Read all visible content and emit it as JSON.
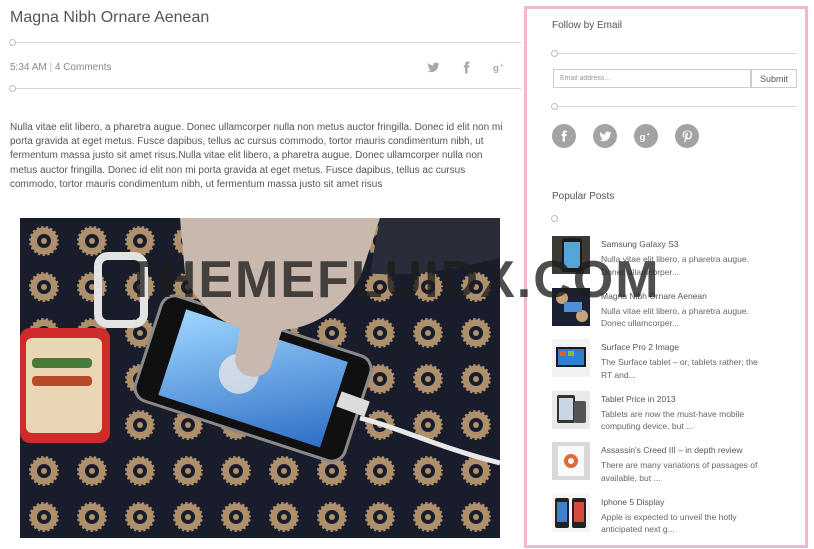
{
  "post": {
    "title": "Magna Nibh Ornare Aenean",
    "time": "5:34 AM",
    "comments": "4 Comments",
    "share_icons": [
      "twitter-icon",
      "facebook-icon",
      "google-plus-icon"
    ],
    "body": "Nulla vitae elit libero, a pharetra augue. Donec ullamcorper nulla non metus auctor fringilla. Donec id elit non mi porta gravida at eget metus. Fusce dapibus, tellus ac cursus commodo, tortor mauris condimentum nibh, ut fermentum massa justo sit amet risus.Nulla vitae elit libero, a pharetra augue. Donec ullamcorper nulla non metus auctor fringilla. Donec id elit non mi porta gravida at eget metus. Fusce dapibus, tellus ac cursus commodo, tortor mauris condimentum nibh, ut fermentum massa justo sit amet risus"
  },
  "sidebar": {
    "follow": {
      "title": "Follow by Email",
      "placeholder": "Email address...",
      "submit": "Submit"
    },
    "social": [
      "facebook-icon",
      "twitter-icon",
      "google-plus-icon",
      "pinterest-icon"
    ],
    "popular": {
      "title": "Popular Posts",
      "items": [
        {
          "title": "Samsung Galaxy S3",
          "desc": "Nulla vitae elit libero, a pharetra augue. Donec ullamcorper..."
        },
        {
          "title": "Magna Nibh Ornare Aenean",
          "desc": "Nulla vitae elit libero, a pharetra augue. Donec ullamcorper..."
        },
        {
          "title": "Surface Pro 2 Image",
          "desc": "The Surface tablet – or, tablets rather; the RT and..."
        },
        {
          "title": "Tablet Price in 2013",
          "desc": "Tablets are now the must-have mobile computing device, but ..."
        },
        {
          "title": "Assassin's Creed III – in depth review",
          "desc": "There are many variations of passages of available, but ..."
        },
        {
          "title": "Iphone 5 Display",
          "desc": "Apple is expected to unveil the hotly anticipated next g..."
        }
      ]
    }
  },
  "watermark": "THEMEFLUIDX.COM",
  "colors": {
    "sidebar_border": "#f0b6d2",
    "icon_grey": "#a3a3a3"
  }
}
